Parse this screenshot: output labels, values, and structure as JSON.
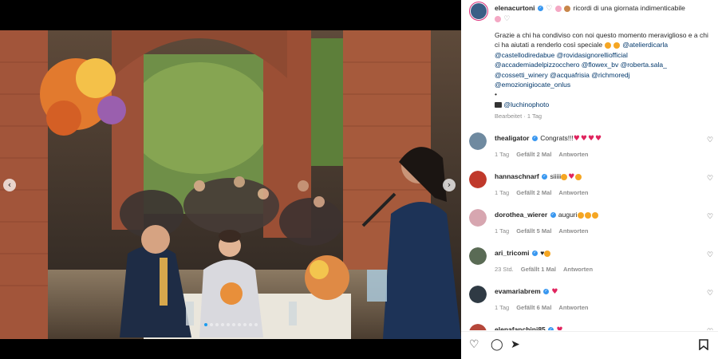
{
  "post": {
    "username": "elenacurtoni",
    "caption_line1": "ricordi di una giornata indimenticabile",
    "caption_body": "Grazie a chi ha condiviso con noi questo momento meraviglioso e a chi ci ha aiutati a renderlo così speciale",
    "mentions_line1": "@atelierdicarla",
    "mentions": [
      "@castellodiredabue @rovidasignorelliofficial",
      "@accademiadelpizzocchero @flowex_bv @roberta.sala_",
      "@cossetti_winery @acquafrisia @richmoredj",
      "@emozionigiocate_onlus"
    ],
    "bullet": "•",
    "photo_credit": "@luchinophoto",
    "meta": "Bearbeitet · 1 Tag"
  },
  "comments": [
    {
      "username": "thealigator",
      "text": "Congrats!!!",
      "time": "1 Tag",
      "likes": "Gefällt 2 Mal",
      "reply": "Antworten",
      "avatar_color": "#6f8aa0",
      "emoji": [
        "heart",
        "heart",
        "heart",
        "heart"
      ]
    },
    {
      "username": "hannaschnarf",
      "text": "siiiii",
      "time": "1 Tag",
      "likes": "Gefällt 2 Mal",
      "reply": "Antworten",
      "avatar_color": "#c0392b",
      "emoji": [
        "orange",
        "heart",
        "orange"
      ]
    },
    {
      "username": "dorothea_wierer",
      "text": "auguri",
      "time": "1 Tag",
      "likes": "Gefällt 5 Mal",
      "reply": "Antworten",
      "avatar_color": "#d7a6b0",
      "emoji": [
        "orange",
        "orange",
        "orange"
      ]
    },
    {
      "username": "ari_tricomi",
      "text": "♥",
      "time": "23 Std.",
      "likes": "Gefällt 1 Mal",
      "reply": "Antworten",
      "avatar_color": "#5a6b55",
      "emoji": [
        "orange"
      ]
    },
    {
      "username": "evamariabrem",
      "text": "",
      "time": "1 Tag",
      "likes": "Gefällt 6 Mal",
      "reply": "Antworten",
      "avatar_color": "#2f3a44",
      "emoji": [
        "heart"
      ]
    },
    {
      "username": "elenafanchini85",
      "text": "",
      "time": "",
      "likes": "",
      "reply": "",
      "avatar_color": "#b5473a",
      "emoji": [
        "heart"
      ]
    }
  ],
  "carousel": {
    "prev": "‹",
    "next": "›",
    "slides": 10,
    "active_index": 0
  },
  "actions": {
    "like": "♡",
    "comment": "◯",
    "share": "➤",
    "save": "🔖"
  },
  "colors": {
    "accent": "#3897f0",
    "mention": "#00376b",
    "muted": "#8e8e8e",
    "heart": "#e0245e",
    "ring": "#d62976"
  }
}
